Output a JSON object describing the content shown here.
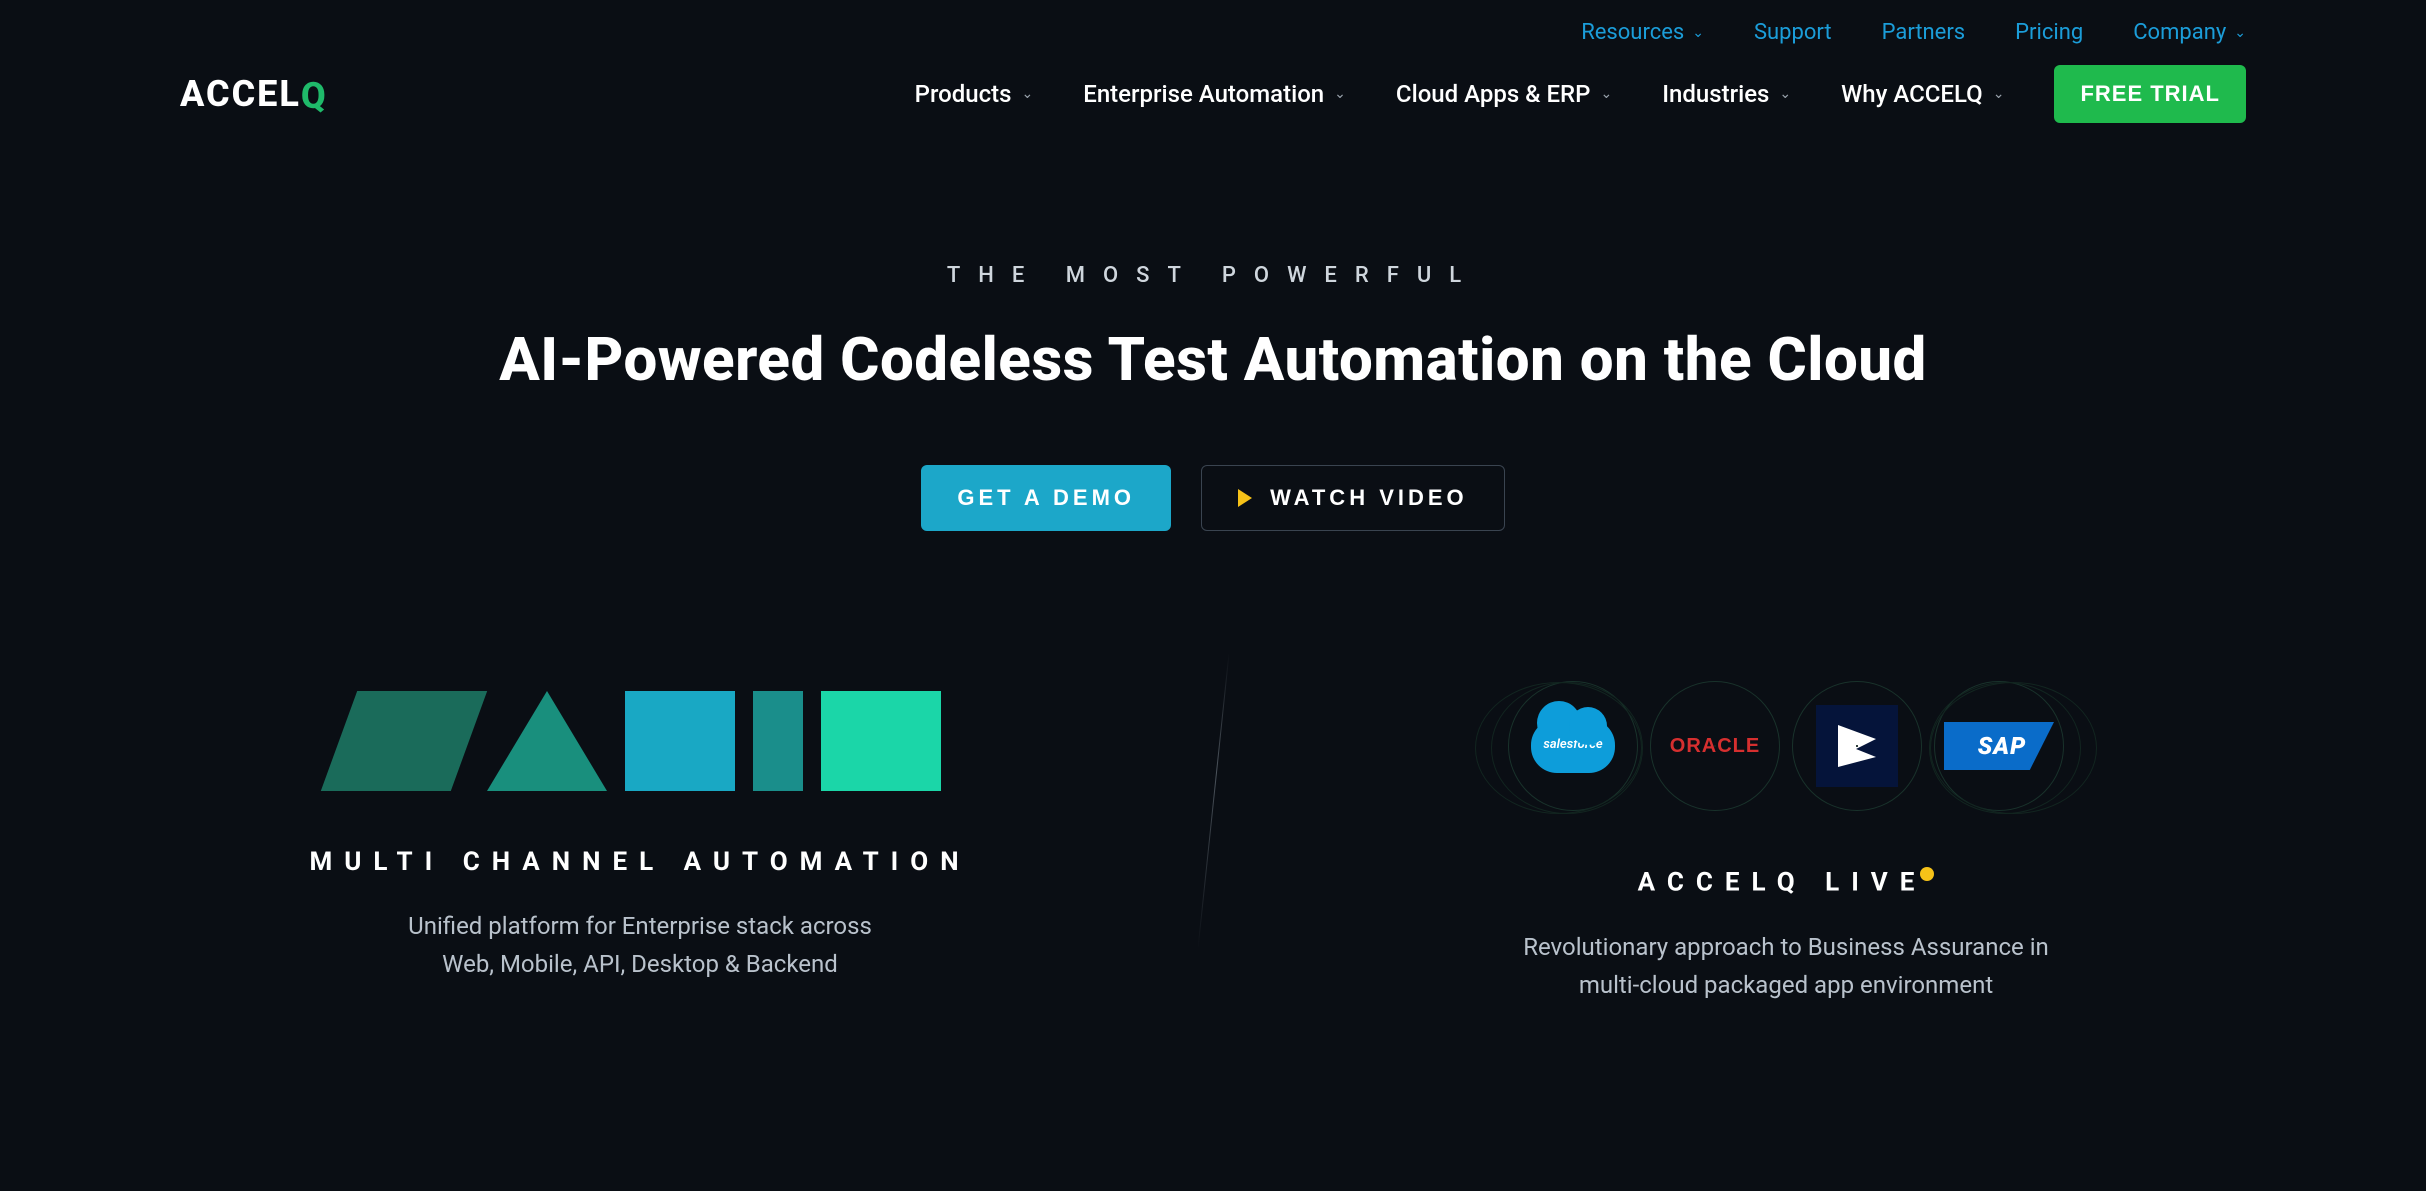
{
  "brand": {
    "name_part1": "ACCEL",
    "name_part2": "Q"
  },
  "topnav": {
    "items": [
      {
        "label": "Resources",
        "has_dropdown": true
      },
      {
        "label": "Support",
        "has_dropdown": false
      },
      {
        "label": "Partners",
        "has_dropdown": false
      },
      {
        "label": "Pricing",
        "has_dropdown": false
      },
      {
        "label": "Company",
        "has_dropdown": true
      }
    ]
  },
  "mainnav": {
    "items": [
      {
        "label": "Products"
      },
      {
        "label": "Enterprise Automation"
      },
      {
        "label": "Cloud Apps & ERP"
      },
      {
        "label": "Industries"
      },
      {
        "label": "Why ACCELQ"
      }
    ],
    "cta": "FREE TRIAL"
  },
  "hero": {
    "eyebrow": "THE MOST POWERFUL",
    "headline": "AI-Powered Codeless Test Automation on the Cloud",
    "demo_button": "GET A DEMO",
    "video_button": "WATCH VIDEO"
  },
  "left_section": {
    "title": "MULTI CHANNEL AUTOMATION",
    "desc_line1": "Unified platform for Enterprise stack across",
    "desc_line2": "Web, Mobile, API, Desktop & Backend"
  },
  "right_section": {
    "title": "ACCELQ LIVE",
    "desc_line1": "Revolutionary approach to Business Assurance in",
    "desc_line2": "multi-cloud packaged app environment",
    "logos": {
      "salesforce": "salesforce",
      "oracle": "ORACLE",
      "dynamics": "Dynamics",
      "sap": "SAP"
    }
  }
}
